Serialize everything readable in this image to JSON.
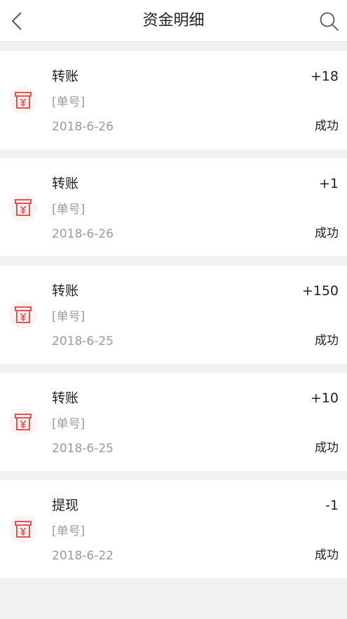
{
  "header": {
    "title": "资金明细",
    "back_icon": "chevron-left-icon",
    "search_icon": "search-icon"
  },
  "colors": {
    "icon_accent": "#e25454",
    "icon_bg": "#fdf3f3"
  },
  "records": [
    {
      "type": "转账",
      "order": "[单号]",
      "date": "2018-6-26",
      "amount": "+18",
      "status": "成功",
      "icon": "yuan-receipt-icon"
    },
    {
      "type": "转账",
      "order": "[单号]",
      "date": "2018-6-26",
      "amount": "+1",
      "status": "成功",
      "icon": "yuan-receipt-icon"
    },
    {
      "type": "转账",
      "order": "[单号]",
      "date": "2018-6-25",
      "amount": "+150",
      "status": "成功",
      "icon": "yuan-receipt-icon"
    },
    {
      "type": "转账",
      "order": "[单号]",
      "date": "2018-6-25",
      "amount": "+10",
      "status": "成功",
      "icon": "yuan-receipt-icon"
    },
    {
      "type": "提现",
      "order": "[单号]",
      "date": "2018-6-22",
      "amount": "-1",
      "status": "成功",
      "icon": "yuan-receipt-icon"
    }
  ]
}
